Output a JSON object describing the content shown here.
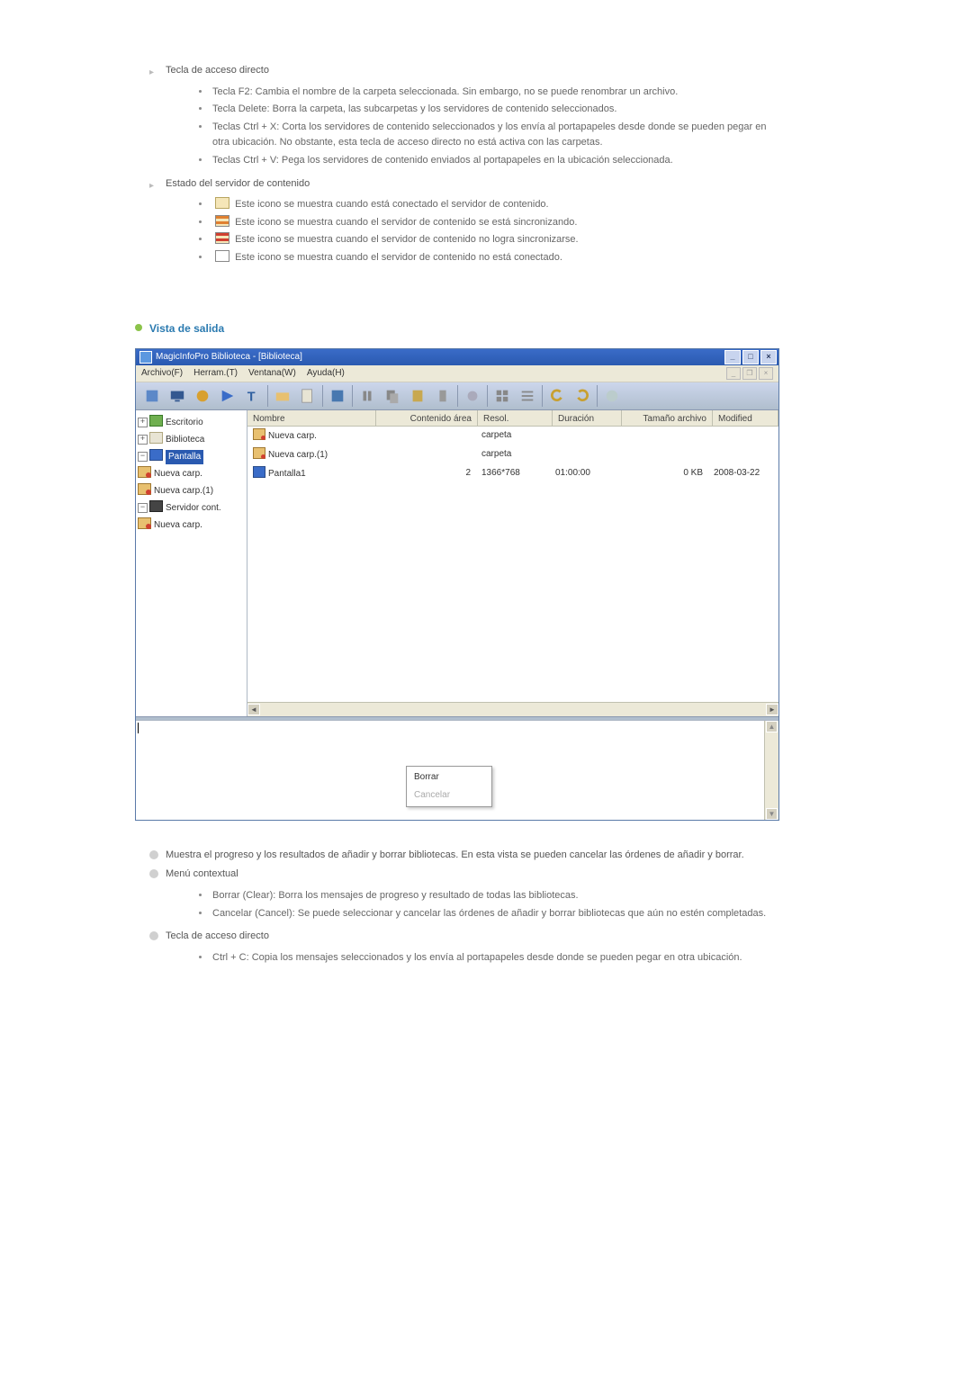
{
  "section1": {
    "heading1": "Tecla de acceso directo",
    "shortcuts": [
      "Tecla F2: Cambia el nombre de la carpeta seleccionada. Sin embargo, no se puede renombrar un archivo.",
      "Tecla Delete: Borra la carpeta, las subcarpetas y los servidores de contenido seleccionados.",
      "Teclas Ctrl + X: Corta los servidores de contenido seleccionados y los envía al portapapeles desde donde se pueden pegar en otra ubicación. No obstante, esta tecla de acceso directo no está activa con las carpetas.",
      "Teclas Ctrl + V: Pega los servidores de contenido enviados al portapapeles en la ubicación seleccionada."
    ],
    "heading2": "Estado del servidor de contenido",
    "statuses": [
      "Este icono se muestra cuando está conectado el servidor de contenido.",
      "Este icono se muestra cuando el servidor de contenido se está sincronizando.",
      "Este icono se muestra cuando el servidor de contenido no logra sincronizarse.",
      "Este icono se muestra cuando el servidor de contenido no está conectado."
    ]
  },
  "section2_title": "Vista de salida",
  "app": {
    "title": "MagicInfoPro Biblioteca - [Biblioteca]",
    "menus": [
      "Archivo(F)",
      "Herram.(T)",
      "Ventana(W)",
      "Ayuda(H)"
    ],
    "tree": {
      "n0": "Escritorio",
      "n1": "Biblioteca",
      "n2": "Pantalla",
      "n3": "Nueva carp.",
      "n4": "Nueva carp.(1)",
      "n5": "Servidor cont.",
      "n6": "Nueva carp."
    },
    "columns": {
      "name": "Nombre",
      "area": "Contenido área",
      "resol": "Resol.",
      "dur": "Duración",
      "size": "Tamaño archivo",
      "mod": "Modified"
    },
    "rows": [
      {
        "name": "Nueva carp.",
        "area": "",
        "resol": "carpeta",
        "dur": "",
        "size": "",
        "mod": ""
      },
      {
        "name": "Nueva carp.(1)",
        "area": "",
        "resol": "carpeta",
        "dur": "",
        "size": "",
        "mod": ""
      },
      {
        "name": "Pantalla1",
        "area": "2",
        "resol": "1366*768",
        "dur": "01:00:00",
        "size": "0 KB",
        "mod": "2008-03-22"
      }
    ],
    "ctx": {
      "clear": "Borrar",
      "cancel": "Cancelar"
    }
  },
  "section3": {
    "intro": "Muestra el progreso y los resultados de añadir y borrar bibliotecas. En esta vista se pueden cancelar las órdenes de añadir y borrar.",
    "heading_menu": "Menú contextual",
    "menu_items": [
      "Borrar (Clear): Borra los mensajes de progreso y resultado de todas las bibliotecas.",
      "Cancelar (Cancel): Se puede seleccionar y cancelar las órdenes de añadir y borrar bibliotecas que aún no estén completadas."
    ],
    "heading_shortcut": "Tecla de acceso directo",
    "shortcut_items": [
      "Ctrl + C: Copia los mensajes seleccionados y los envía al portapapeles desde donde se pueden pegar en otra ubicación."
    ]
  }
}
